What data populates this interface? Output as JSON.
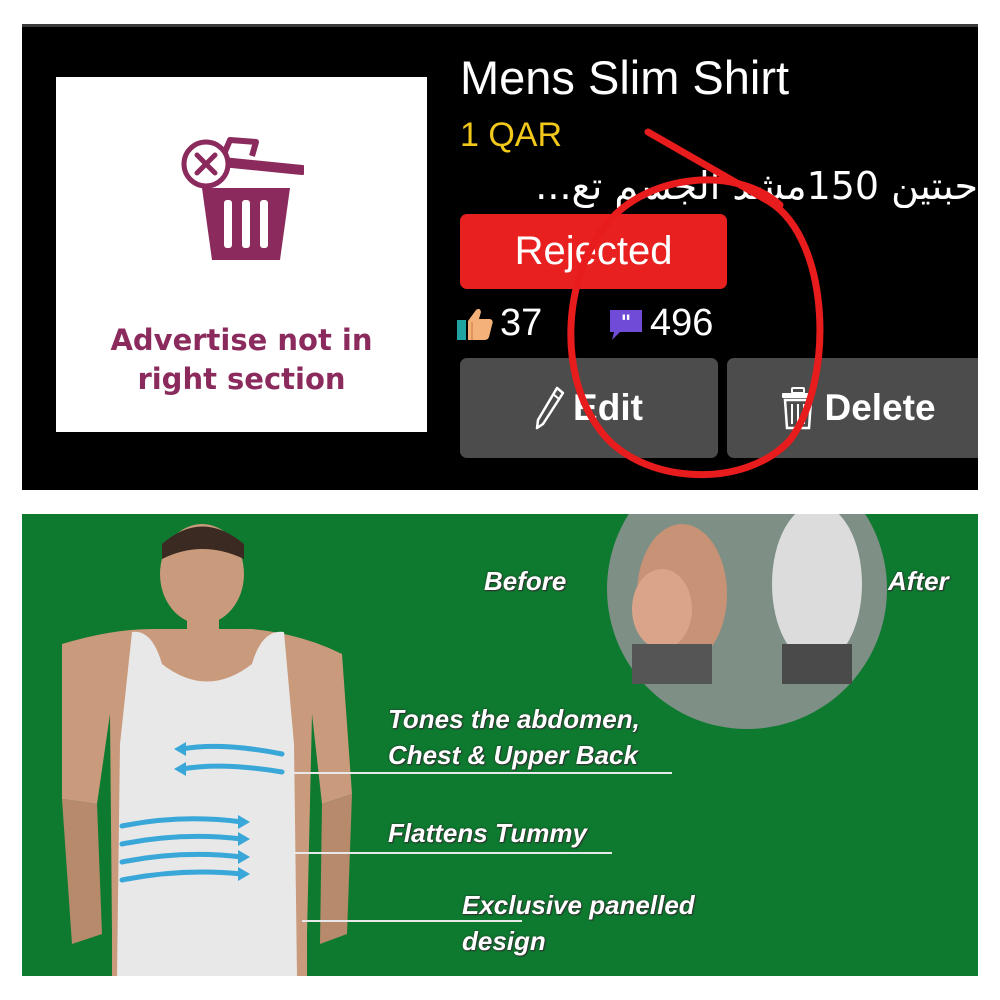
{
  "listing": {
    "title": "Mens Slim Shirt",
    "price": "1 QAR",
    "description": "حبتين 150مشد الجسم تع...",
    "status": "Rejected",
    "likes": "37",
    "comments": "496",
    "thumbnail_reason": "Advertise not in right section",
    "edit_label": "Edit",
    "delete_label": "Delete"
  },
  "icons": {
    "thumbnail": "trash-x-icon",
    "likes": "thumbs-up-icon",
    "comments": "quote-bubble-icon",
    "edit": "pencil-icon",
    "delete": "trash-icon"
  },
  "colors": {
    "card_background": "#000000",
    "price": "#f2c81a",
    "status_rejected": "#e8201f",
    "button": "#4c4c4c",
    "reason_text": "#8b2b5d",
    "annotation": "#e81c1c",
    "promo_background": "#0d7a2f"
  },
  "promo": {
    "before": "Before",
    "after": "After",
    "feature1_line1": "Tones the abdomen,",
    "feature1_line2": "Chest & Upper Back",
    "feature2": "Flattens Tummy",
    "feature3_line1": "Exclusive panelled",
    "feature3_line2": "design"
  }
}
